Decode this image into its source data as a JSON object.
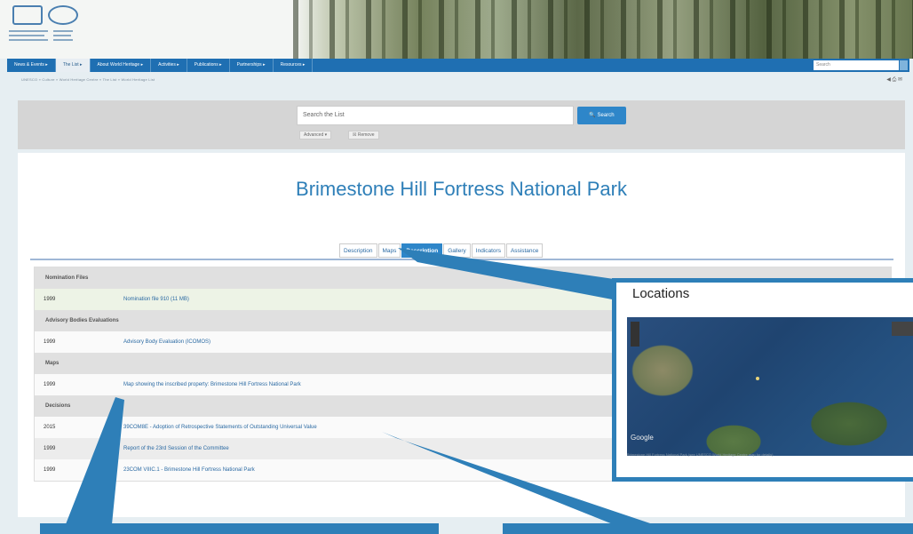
{
  "header": {
    "nav_items": [
      "News & Events ▸",
      "The List ▸",
      "About World Heritage ▸",
      "Activities ▸",
      "Publications ▸",
      "Partnerships ▸",
      "Resources ▸"
    ],
    "search_placeholder": "Search",
    "breadcrumb": "UNESCO » Culture » World Heritage Centre » The List » World Heritage List",
    "share_icons": "◀ ⎙ ✉"
  },
  "search": {
    "placeholder": "Search the List",
    "button_label": "🔍 Search",
    "advanced_label": "Advanced ▾",
    "remove_label": "☒ Remove"
  },
  "page": {
    "title": "Brimestone Hill Fortress National Park"
  },
  "tabs": [
    {
      "label": "Description",
      "active": false
    },
    {
      "label": "Maps",
      "active": false
    },
    {
      "label": "Description",
      "active": true
    },
    {
      "label": "Gallery",
      "active": false
    },
    {
      "label": "Indicators",
      "active": false
    },
    {
      "label": "Assistance",
      "active": false
    }
  ],
  "documents": {
    "sections": [
      {
        "heading": "Nomination Files",
        "rows": [
          {
            "year": "1999",
            "text": "Nomination file 910 (11 MB)",
            "style": "alt"
          }
        ]
      },
      {
        "heading": "Advisory Bodies Evaluations",
        "rows": [
          {
            "year": "1999",
            "text": "Advisory Body Evaluation (ICOMOS)",
            "style": "plain"
          }
        ]
      },
      {
        "heading": "Maps",
        "rows": [
          {
            "year": "1999",
            "text": "Map showing the inscribed property: Brimestone Hill Fortress National Park",
            "style": "plain"
          }
        ]
      },
      {
        "heading": "Decisions",
        "rows": [
          {
            "year": "2015",
            "text": "39COM8E - Adoption of Retrospective Statements of Outstanding Universal Value",
            "style": "plain"
          },
          {
            "year": "1999",
            "text": "Report of the 23rd Session of the Committee",
            "style": "grey"
          },
          {
            "year": "1999",
            "text": "23COM VIIIC.1 - Brimestone Hill Fortress National Park",
            "style": "plain"
          }
        ]
      }
    ]
  },
  "locations": {
    "title": "Locations",
    "google_label": "Google",
    "caption": "Brimestone Hill Fortress National Park (see UNESCO World Heritage Centre map for details)"
  },
  "colors": {
    "accent": "#2e7fb8",
    "nav": "#1f6fb2",
    "link": "#2b6aa3"
  }
}
